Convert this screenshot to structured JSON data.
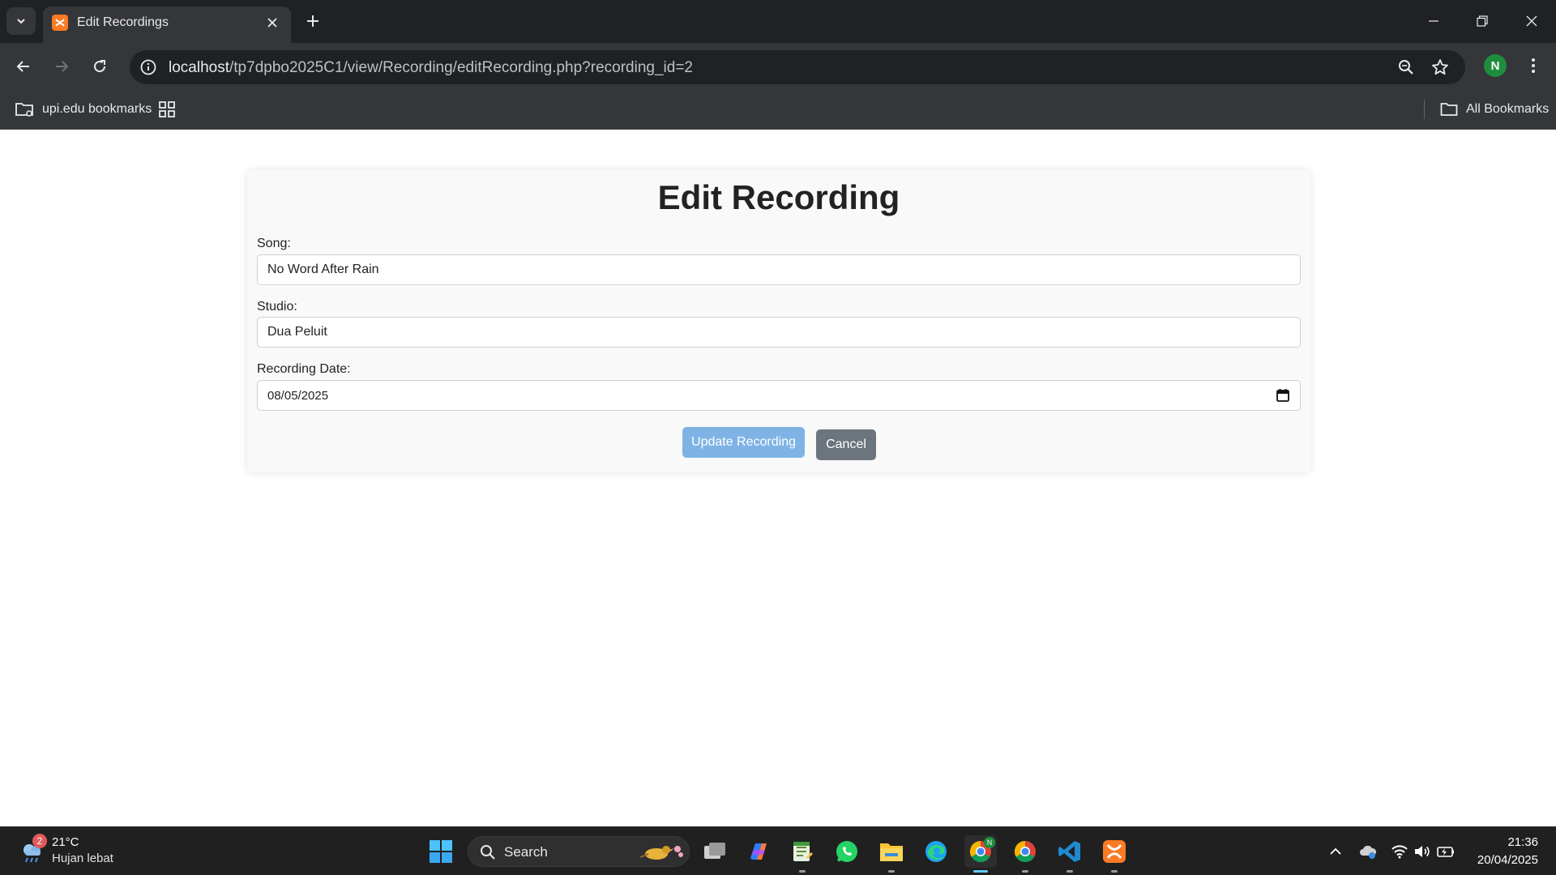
{
  "browser": {
    "tab_title": "Edit Recordings",
    "url_host": "localhost",
    "url_path": "/tp7dpbo2025C1/view/Recording/editRecording.php?recording_id=2",
    "profile_initial": "N",
    "bookmarks": {
      "folder_label": "upi.edu bookmarks",
      "all_label": "All Bookmarks"
    }
  },
  "page": {
    "heading": "Edit Recording",
    "fields": {
      "song": {
        "label": "Song:",
        "value": "No Word After Rain"
      },
      "studio": {
        "label": "Studio:",
        "value": "Dua Peluit"
      },
      "date": {
        "label": "Recording Date:",
        "value": "08/05/2025"
      }
    },
    "buttons": {
      "update_label": "Update Recording",
      "cancel_label": "Cancel"
    }
  },
  "taskbar": {
    "weather_badge": "2",
    "weather_temp": "21°C",
    "weather_desc": "Hujan lebat",
    "search_label": "Search",
    "time": "21:36",
    "date": "20/04/2025",
    "profile_initial": "N"
  },
  "colors": {
    "chrome_dark": "#202124",
    "chrome_toolbar": "#35363a",
    "update_button": "#7fb3e6",
    "cancel_button": "#6c757d",
    "taskbar": "#202020"
  }
}
